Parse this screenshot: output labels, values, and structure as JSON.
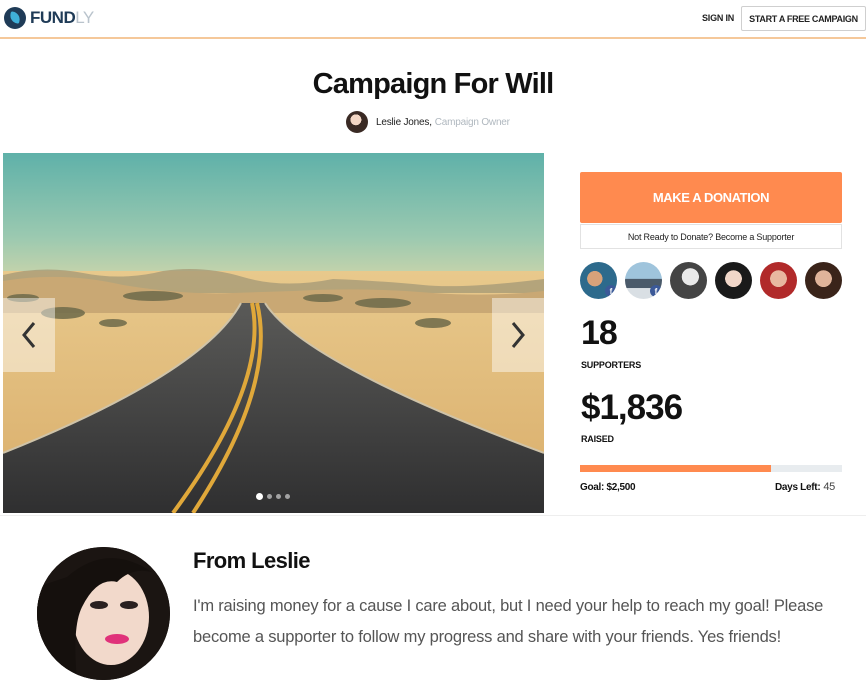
{
  "header": {
    "logo_text": "FUND",
    "logo_text_suffix": "LY",
    "sign_in": "SIGN IN",
    "start_campaign": "START A FREE CAMPAIGN"
  },
  "campaign": {
    "title": "Campaign For Will",
    "owner_name": "Leslie Jones,",
    "owner_role": "Campaign Owner"
  },
  "carousel": {
    "active_slide": 1,
    "slide_count": 4
  },
  "sidebar": {
    "donate_label": "MAKE A DONATION",
    "supporter_link": "Not Ready to Donate? Become a Supporter",
    "supporters_count": "18",
    "supporters_label": "SUPPORTERS",
    "raised_amount": "$1,836",
    "raised_label": "RAISED",
    "progress_fraction": 0.73,
    "goal": "Goal: $2,500",
    "days_left_label": "Days Left:",
    "days_left_value": "45"
  },
  "from": {
    "title": "From Leslie",
    "body": "I'm raising money for a cause I care about, but I need your help to reach my goal! Please become a supporter to follow my progress and share with your friends. Yes friends!"
  },
  "colors": {
    "accent": "#ff8a4f",
    "brand": "#1f3b57",
    "facebook": "#3b5998"
  }
}
